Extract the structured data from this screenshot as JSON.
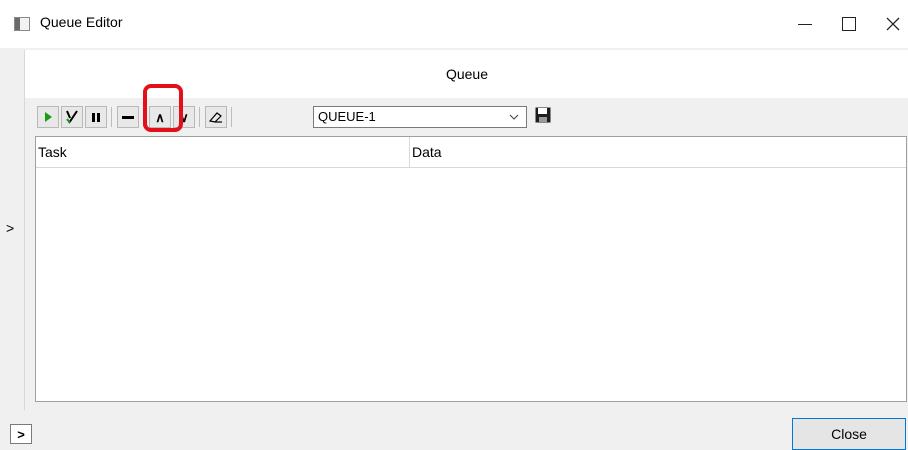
{
  "window": {
    "title": "Queue Editor",
    "controls": {
      "minimize": "minimize-icon",
      "maximize": "maximize-icon",
      "close": "close-icon"
    }
  },
  "panel": {
    "title": "Queue"
  },
  "toolbar": {
    "buttons": [
      "play-icon",
      "check-run-icon",
      "pause-icon",
      "remove-icon",
      "move-up-icon",
      "move-down-icon",
      "eraser-icon"
    ],
    "up_glyph": "∧",
    "down_glyph": "∨",
    "queue_select": {
      "value": "QUEUE-1"
    },
    "save_icon": "save-icon",
    "highlight_color": "#e3101b"
  },
  "grid": {
    "columns": [
      "Task",
      "Data"
    ],
    "rows": []
  },
  "side_toggle_glyph": ">",
  "footer": {
    "expand_glyph": ">",
    "close_label": "Close"
  }
}
